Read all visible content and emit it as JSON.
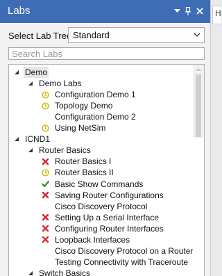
{
  "header": {
    "title": "Labs"
  },
  "right_tab": {
    "label": "H"
  },
  "selector": {
    "label": "Select Lab Tree:",
    "value": "Standard"
  },
  "search": {
    "placeholder": "Search Labs"
  },
  "colors": {
    "titlebar": "#3e6db5",
    "status_error": "#d7262b",
    "status_success": "#2e8b3a",
    "status_progress": "#c9b400"
  },
  "tree": {
    "rows": [
      {
        "label": "Demo",
        "level": 0,
        "expander": "expanded",
        "status": "none",
        "selected": true
      },
      {
        "label": "Demo Labs",
        "level": 1,
        "expander": "expanded",
        "status": "none"
      },
      {
        "label": "Configuration Demo 1",
        "level": 2,
        "status": "in-progress"
      },
      {
        "label": "Topology Demo",
        "level": 2,
        "status": "in-progress"
      },
      {
        "label": "Configuration Demo 2",
        "level": 2,
        "status": "none"
      },
      {
        "label": "Using NetSim",
        "level": 2,
        "status": "in-progress"
      },
      {
        "label": "ICND1",
        "level": 0,
        "expander": "expanded",
        "status": "none"
      },
      {
        "label": "Router Basics",
        "level": 1,
        "expander": "expanded",
        "status": "none"
      },
      {
        "label": "Router Basics I",
        "level": 2,
        "status": "failed"
      },
      {
        "label": "Router Basics II",
        "level": 2,
        "status": "in-progress"
      },
      {
        "label": "Basic Show Commands",
        "level": 2,
        "status": "passed"
      },
      {
        "label": "Saving Router Configurations",
        "level": 2,
        "status": "failed"
      },
      {
        "label": "Cisco Discovery Protocol",
        "level": 2,
        "status": "none"
      },
      {
        "label": "Setting Up a Serial Interface",
        "level": 2,
        "status": "failed"
      },
      {
        "label": "Configuring Router Interfaces",
        "level": 2,
        "status": "failed"
      },
      {
        "label": "Loopback Interfaces",
        "level": 2,
        "status": "failed"
      },
      {
        "label": "Cisco Discovery Protocol on a Router",
        "level": 2,
        "status": "none"
      },
      {
        "label": "Testing Connectivity with Traceroute",
        "level": 2,
        "status": "none"
      },
      {
        "label": "Switch Basics",
        "level": 1,
        "expander": "expanded",
        "status": "none"
      }
    ]
  }
}
